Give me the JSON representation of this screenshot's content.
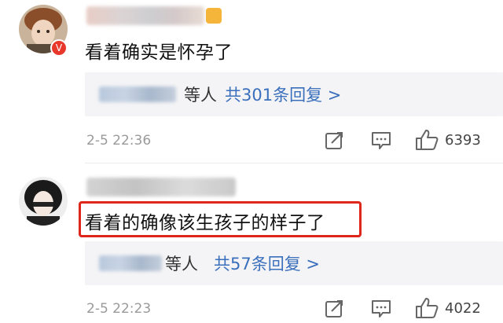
{
  "comments": [
    {
      "text": "看着确实是怀孕了",
      "reply_suffix": "等人",
      "reply_link": "共301条回复 >",
      "timestamp": "2-5 22:36",
      "likes": "6393",
      "badge": "V"
    },
    {
      "text": "看着的确像该生孩子的样子了",
      "reply_suffix": "等人",
      "reply_link": "共57条回复 >",
      "timestamp": "2-5 22:23",
      "likes": "4022"
    }
  ],
  "colors": {
    "reply_link": "#3a6fbc",
    "highlight_border": "#e0251b",
    "badge": "#e8372b",
    "timestamp": "#9a9a9a"
  },
  "icons": [
    "share-icon",
    "comment-icon",
    "like-icon"
  ]
}
